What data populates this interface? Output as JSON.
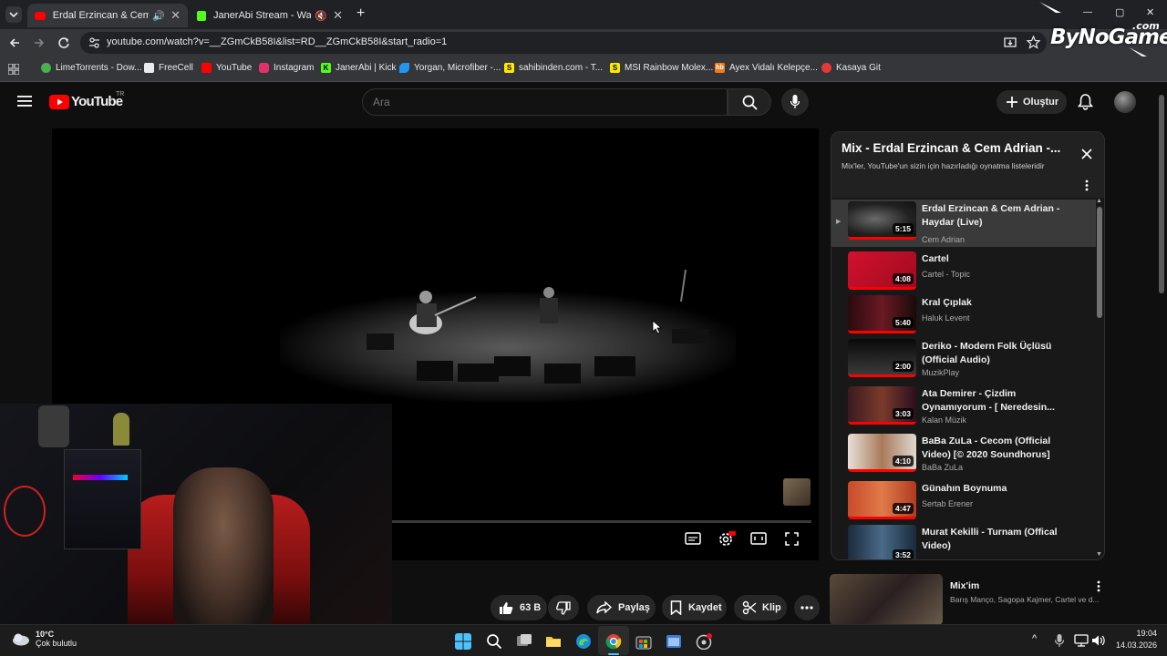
{
  "browser": {
    "tabs": [
      {
        "title": "Erdal Erzincan & Cem Adrian",
        "active": true
      },
      {
        "title": "JanerAbi Stream - Watch Li",
        "active": false
      }
    ],
    "new_tab": "+",
    "url": "youtube.com/watch?v=__ZGmCkB58I&list=RD__ZGmCkB58I&start_radio=1",
    "window_controls": [
      "—",
      "▢",
      "✕"
    ],
    "bookmarks": [
      {
        "label": "LimeTorrents - Dow...",
        "color": "#4caf50"
      },
      {
        "label": "FreeCell",
        "color": "#e8eaed"
      },
      {
        "label": "YouTube",
        "color": "#ff0000"
      },
      {
        "label": "Instagram",
        "color": "#e1306c"
      },
      {
        "label": "JanerAbi | Kick",
        "color": "#53fc18"
      },
      {
        "label": "Yorgan, Microfiber -...",
        "color": "#2196f3"
      },
      {
        "label": "sahibinden.com - T...",
        "color": "#ffe800"
      },
      {
        "label": "MSI Rainbow Molex...",
        "color": "#ffe800"
      },
      {
        "label": "Ayex Vidalı Kelepçe...",
        "color": "#f27a1a"
      },
      {
        "label": "Kasaya Git",
        "color": "#e53935"
      }
    ]
  },
  "watermark": {
    "brand": "ByNoGame",
    "suffix": ".com"
  },
  "youtube": {
    "logo": "YouTube",
    "region": "TR",
    "search_placeholder": "Ara",
    "create_label": "Oluştur"
  },
  "actions": {
    "likes": "63 B",
    "share": "Paylaş",
    "save": "Kaydet",
    "clip": "Klip"
  },
  "playlist": {
    "title": "Mix - Erdal Erzincan & Cem Adrian -...",
    "subtitle": "Mix'ler, YouTube'un sizin için hazırladığı oynatma listeleridir",
    "items": [
      {
        "title": "Erdal Erzincan & Cem Adrian - Haydar (Live)",
        "channel": "Cem Adrian",
        "duration": "5:15",
        "active": true
      },
      {
        "title": "Cartel",
        "channel": "Cartel - Topic",
        "duration": "4:08",
        "active": false
      },
      {
        "title": "Kral Çıplak",
        "channel": "Haluk Levent",
        "duration": "5:40",
        "active": false
      },
      {
        "title": "Deriko - Modern Folk Üçlüsü (Official Audio)",
        "channel": "MuzikPlay",
        "duration": "2:00",
        "active": false
      },
      {
        "title": "Ata Demirer - Çizdim Oynamıyorum - [ Neredesin...",
        "channel": "Kalan Müzik",
        "duration": "3:03",
        "active": false
      },
      {
        "title": "BaBa ZuLa - Cecom (Official Video) [© 2020 Soundhorus]",
        "channel": "BaBa ZuLa",
        "duration": "4:10",
        "active": false
      },
      {
        "title": "Günahın Boynuma",
        "channel": "Sertab Erener",
        "duration": "4:47",
        "active": false
      },
      {
        "title": "Murat Kekilli - Turnam (Offical Video)",
        "channel": "",
        "duration": "3:52",
        "active": false
      }
    ]
  },
  "recommendation": {
    "title": "Mix'im",
    "subtitle": "Barış Manço, Sagopa Kajmer, Cartel ve d..."
  },
  "taskbar": {
    "weather_temp": "10°C",
    "weather_desc": "Çok bulutlu",
    "time": "19:04",
    "date": "14.03.2026"
  }
}
